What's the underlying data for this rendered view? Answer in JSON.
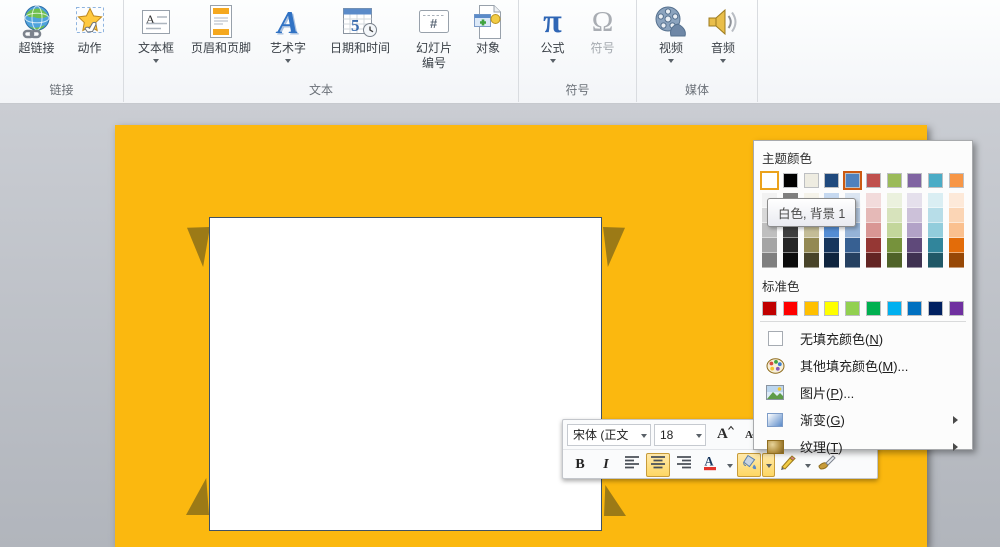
{
  "ribbon": {
    "groups": [
      {
        "label": "链接",
        "items": [
          {
            "label": "超链接",
            "icon": "hyperlink-globe-icon"
          },
          {
            "label": "动作",
            "icon": "action-star-icon"
          }
        ]
      },
      {
        "label": "文本",
        "items": [
          {
            "label": "文本框",
            "icon": "text-box-icon",
            "arrow": true
          },
          {
            "label": "页眉和页脚",
            "icon": "header-footer-icon"
          },
          {
            "label": "艺术字",
            "icon": "wordart-icon",
            "arrow": true
          },
          {
            "label": "日期和时间",
            "icon": "date-time-icon"
          },
          {
            "label": "幻灯片",
            "label2": "编号",
            "icon": "slide-number-icon"
          },
          {
            "label": "对象",
            "icon": "object-icon"
          }
        ]
      },
      {
        "label": "符号",
        "items": [
          {
            "label": "公式",
            "icon": "equation-icon",
            "arrow": true
          },
          {
            "label": "符号",
            "icon": "omega-symbol-icon",
            "disabled": true
          }
        ]
      },
      {
        "label": "媒体",
        "items": [
          {
            "label": "视频",
            "icon": "video-icon",
            "arrow": true
          },
          {
            "label": "音频",
            "icon": "audio-icon",
            "arrow": true
          }
        ]
      }
    ]
  },
  "mini_toolbar": {
    "font_name": "宋体 (正文",
    "font_size": "18",
    "bold_label": "B",
    "italic_label": "I"
  },
  "fill_menu": {
    "theme_title": "主题颜色",
    "standard_title": "标准色",
    "theme_colors": [
      "#FFFFFF",
      "#000000",
      "#EEECE1",
      "#1F497D",
      "#4F81BD",
      "#C0504D",
      "#9BBB59",
      "#8064A2",
      "#4BACC6",
      "#F79646"
    ],
    "theme_tints": [
      [
        "#F2F2F2",
        "#D8D8D8",
        "#BFBFBF",
        "#A5A5A5",
        "#7F7F7F"
      ],
      [
        "#7F7F7F",
        "#595959",
        "#3F3F3F",
        "#262626",
        "#0C0C0C"
      ],
      [
        "#F5F3EA",
        "#DDD9C3",
        "#C4BD97",
        "#938953",
        "#494429"
      ],
      [
        "#C6D9F0",
        "#8DB3E2",
        "#548DD4",
        "#17365D",
        "#0F243E"
      ],
      [
        "#DBE5F1",
        "#B8CCE4",
        "#95B3D7",
        "#376092",
        "#254061"
      ],
      [
        "#F2DBDB",
        "#E5B9B7",
        "#D99694",
        "#953734",
        "#632423"
      ],
      [
        "#EBF1DE",
        "#D7E3BC",
        "#C3D69B",
        "#76923C",
        "#4F6228"
      ],
      [
        "#E5E0EC",
        "#CCC1D9",
        "#B2A2C7",
        "#5F497A",
        "#3F3151"
      ],
      [
        "#DAEEF3",
        "#B7DDE8",
        "#92CDDC",
        "#31859B",
        "#205867"
      ],
      [
        "#FDE9D9",
        "#FBD5B5",
        "#FAC08F",
        "#E36C09",
        "#974806"
      ]
    ],
    "standard_colors": [
      "#C00000",
      "#FF0000",
      "#FFC000",
      "#FFFF00",
      "#92D050",
      "#00B050",
      "#00B0F0",
      "#0070C0",
      "#002060",
      "#7030A0"
    ],
    "hovered_theme_index": 0,
    "selected_theme_index": 4,
    "items": [
      {
        "icon": "no-fill-icon",
        "prefix": "无填充颜色(",
        "key": "N",
        "suffix": ")"
      },
      {
        "icon": "more-colors-icon",
        "prefix": "其他填充颜色(",
        "key": "M",
        "suffix": ")..."
      },
      {
        "icon": "picture-icon",
        "prefix": "图片(",
        "key": "P",
        "suffix": ")..."
      },
      {
        "icon": "gradient-icon",
        "prefix": "渐变(",
        "key": "G",
        "suffix": ")",
        "submenu": true
      },
      {
        "icon": "texture-icon",
        "prefix": "纹理(",
        "key": "T",
        "suffix": ")",
        "submenu": true
      }
    ]
  },
  "tooltip": {
    "text": "白色, 背景 1"
  },
  "colors": {
    "slide_fill": "#FBB80F",
    "corner_triangle": "#9C7A16",
    "shape_border": "#3F5266"
  }
}
